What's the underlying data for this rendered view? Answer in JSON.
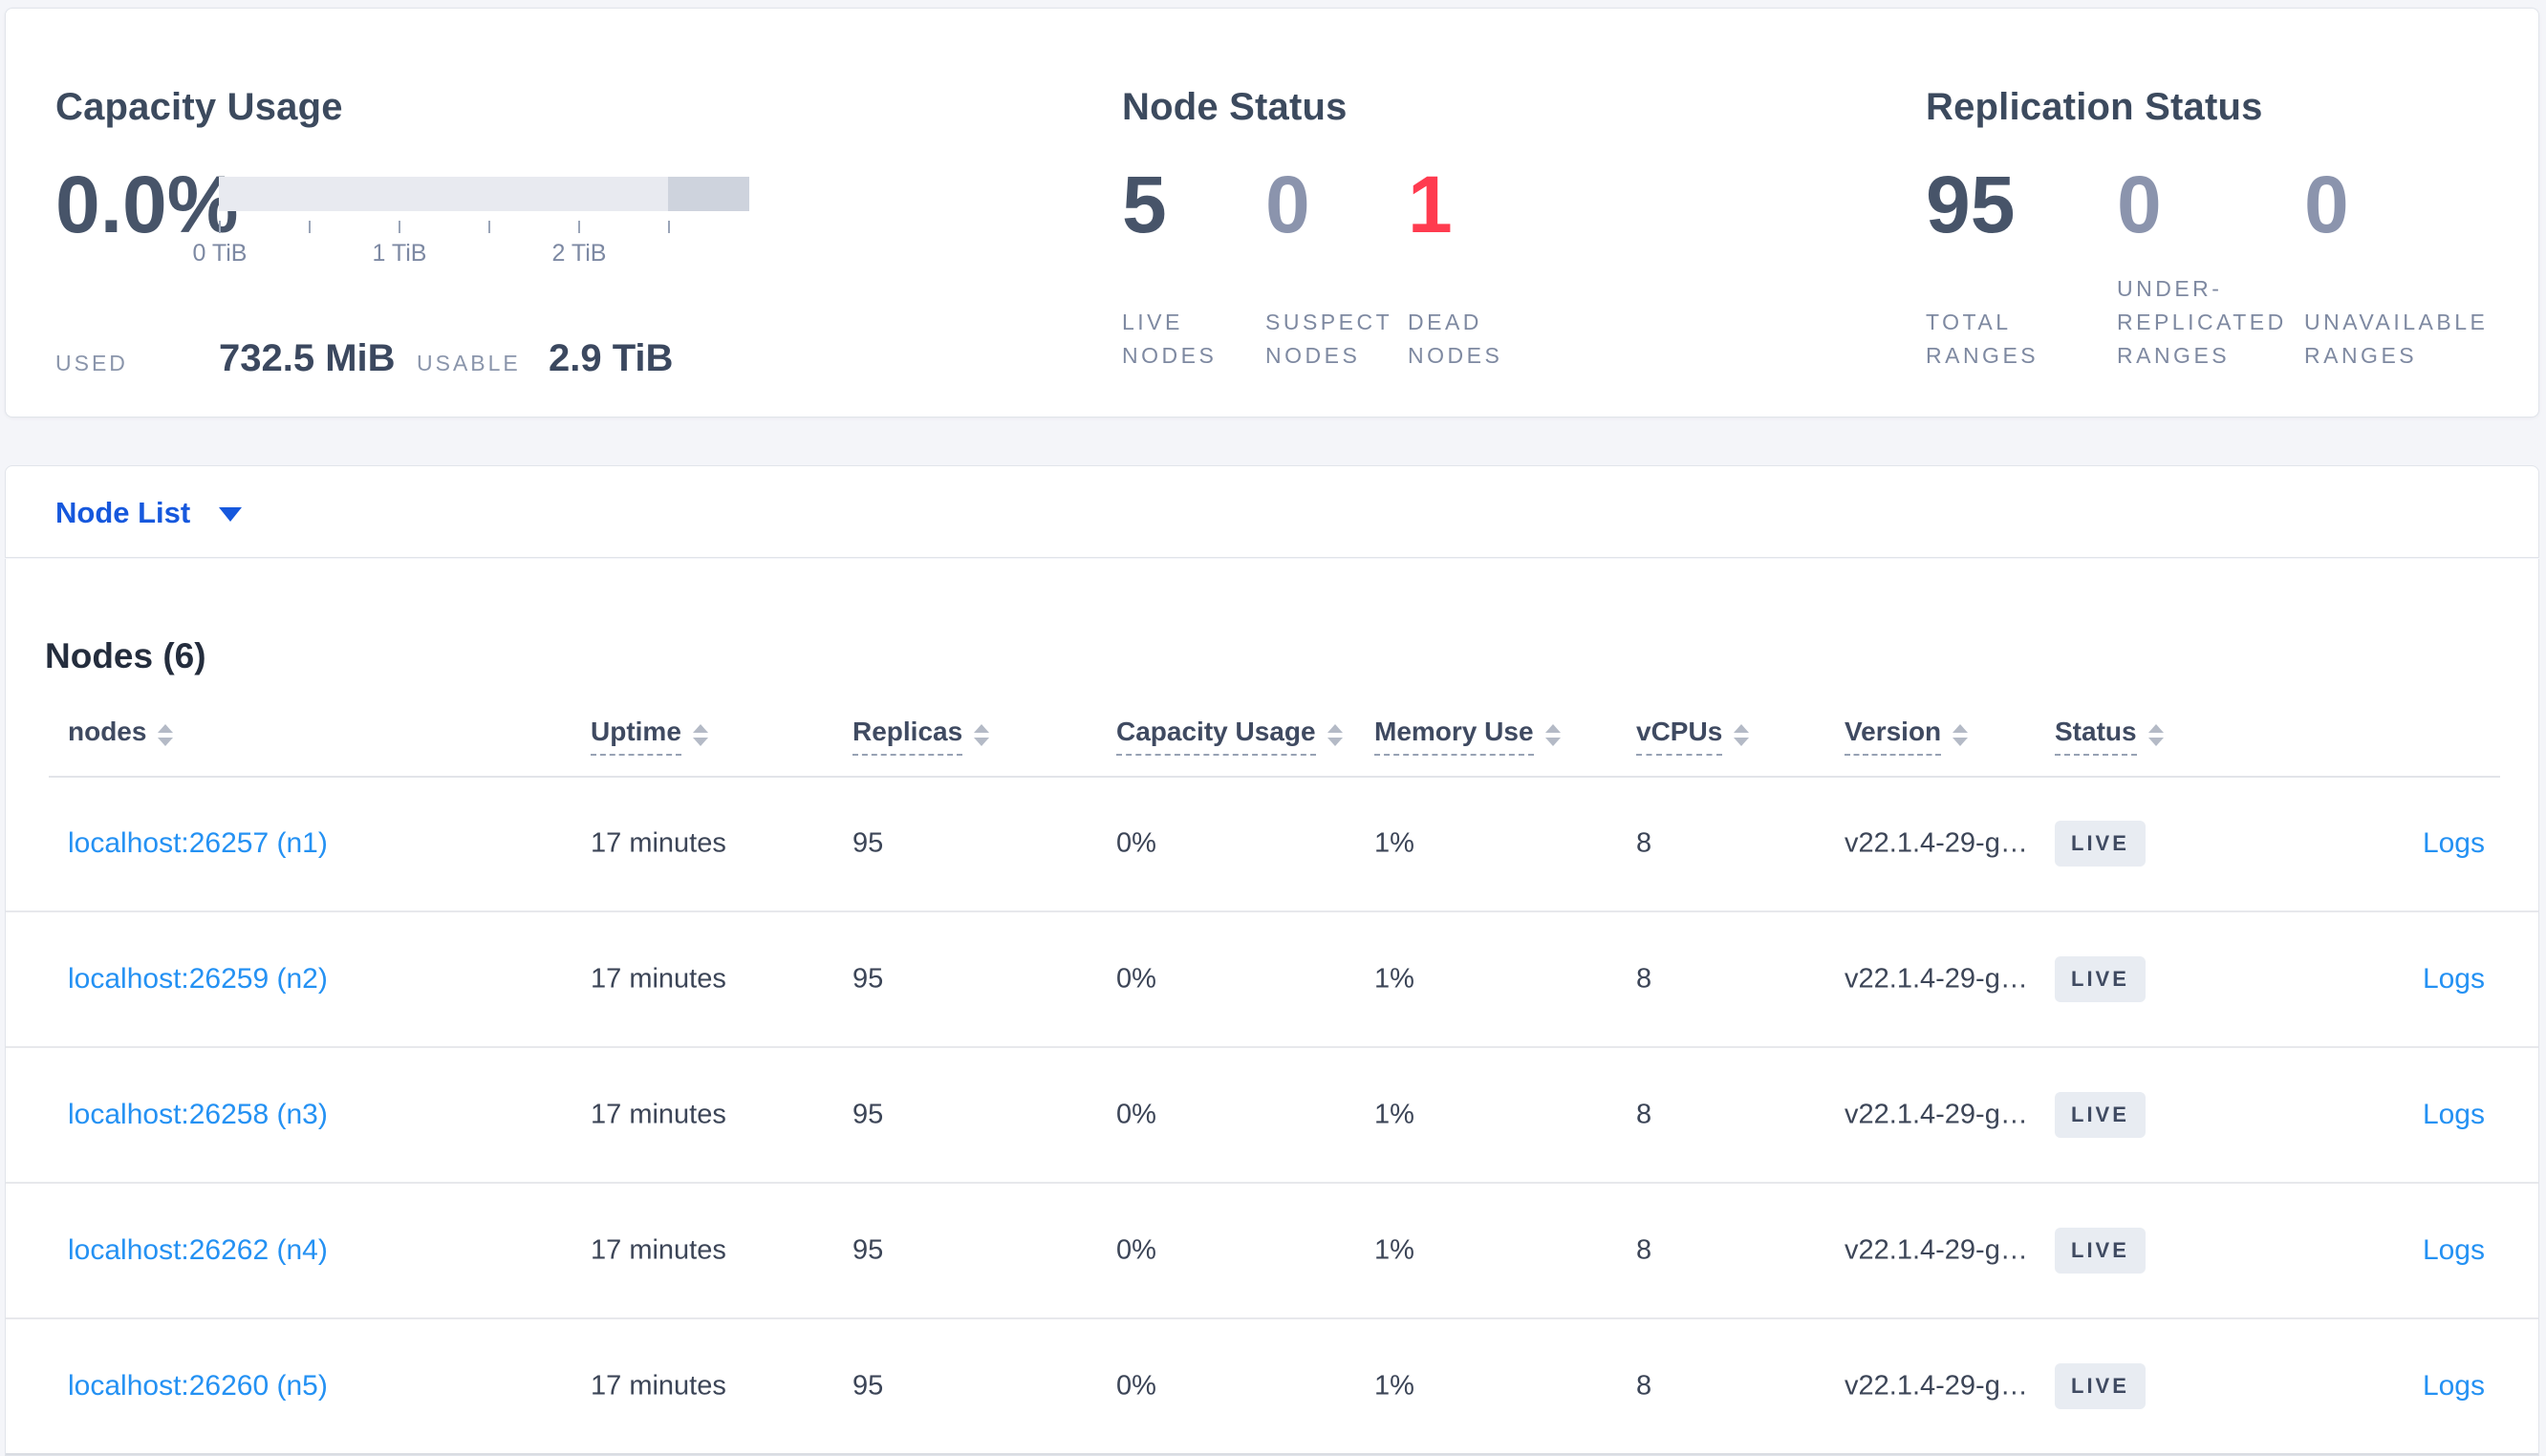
{
  "colors": {
    "accent_blue": "#1658dd",
    "link_blue": "#2491f3",
    "danger_red": "#ff3b4f",
    "stat_primary": "#475469",
    "stat_muted": "#8b94ad",
    "badge_bg": "#e8ecf2",
    "gauge_light": "#e8eaf0",
    "gauge_dark": "#ced3dd"
  },
  "summary": {
    "capacity": {
      "title": "Capacity Usage",
      "percent": "0.0%",
      "tick_labels": [
        "0 TiB",
        "1 TiB",
        "2 TiB"
      ],
      "used_label": "USED",
      "used_value": "732.5 MiB",
      "usable_label": "USABLE",
      "usable_value": "2.9 TiB"
    },
    "node_status": {
      "title": "Node Status",
      "stats": [
        {
          "value": "5",
          "line1": "LIVE",
          "line2": "NODES"
        },
        {
          "value": "0",
          "line1": "SUSPECT",
          "line2": "NODES"
        },
        {
          "value": "1",
          "line1": "DEAD",
          "line2": "NODES"
        }
      ]
    },
    "replication": {
      "title": "Replication Status",
      "stats": [
        {
          "value": "95",
          "line1": "TOTAL",
          "line2": "RANGES"
        },
        {
          "value": "0",
          "line0": "UNDER-",
          "line1": "REPLICATED",
          "line2": "RANGES"
        },
        {
          "value": "0",
          "line1": "UNAVAILABLE",
          "line2": "RANGES"
        }
      ]
    }
  },
  "view_selector": {
    "label": "Node List"
  },
  "nodes": {
    "heading": "Nodes (6)",
    "columns": {
      "nodes": "nodes",
      "uptime": "Uptime",
      "replicas": "Replicas",
      "capacity": "Capacity Usage",
      "memory": "Memory Use",
      "vcpus": "vCPUs",
      "version": "Version",
      "status": "Status"
    },
    "rows": [
      {
        "address": "localhost:26257 (n1)",
        "uptime": "17 minutes",
        "replicas": "95",
        "capacity": "0%",
        "memory": "1%",
        "vcpus": "8",
        "version": "v22.1.4-29-g…",
        "status": "LIVE",
        "logs": "Logs"
      },
      {
        "address": "localhost:26259 (n2)",
        "uptime": "17 minutes",
        "replicas": "95",
        "capacity": "0%",
        "memory": "1%",
        "vcpus": "8",
        "version": "v22.1.4-29-g…",
        "status": "LIVE",
        "logs": "Logs"
      },
      {
        "address": "localhost:26258 (n3)",
        "uptime": "17 minutes",
        "replicas": "95",
        "capacity": "0%",
        "memory": "1%",
        "vcpus": "8",
        "version": "v22.1.4-29-g…",
        "status": "LIVE",
        "logs": "Logs"
      },
      {
        "address": "localhost:26262 (n4)",
        "uptime": "17 minutes",
        "replicas": "95",
        "capacity": "0%",
        "memory": "1%",
        "vcpus": "8",
        "version": "v22.1.4-29-g…",
        "status": "LIVE",
        "logs": "Logs"
      },
      {
        "address": "localhost:26260 (n5)",
        "uptime": "17 minutes",
        "replicas": "95",
        "capacity": "0%",
        "memory": "1%",
        "vcpus": "8",
        "version": "v22.1.4-29-g…",
        "status": "LIVE",
        "logs": "Logs"
      }
    ]
  }
}
